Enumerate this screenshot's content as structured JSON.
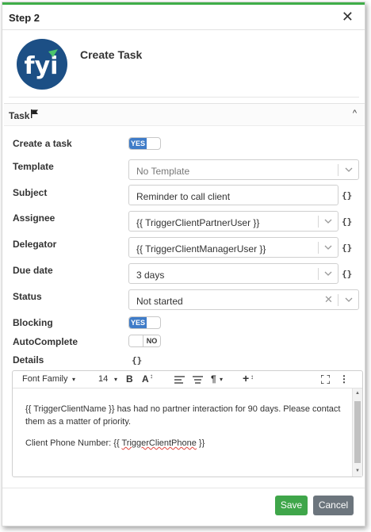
{
  "dialog": {
    "title": "Step 2"
  },
  "app": {
    "name": "Create Task",
    "logo_text": "fyi"
  },
  "section": {
    "label": "Task"
  },
  "form": {
    "create_task": {
      "label": "Create a task",
      "toggle": "YES"
    },
    "template": {
      "label": "Template",
      "value": "No Template"
    },
    "subject": {
      "label": "Subject",
      "value": "Reminder to call client"
    },
    "assignee": {
      "label": "Assignee",
      "value": "{{ TriggerClientPartnerUser }}"
    },
    "delegator": {
      "label": "Delegator",
      "value": "{{ TriggerClientManagerUser }}"
    },
    "due_date": {
      "label": "Due date",
      "value": "3 days"
    },
    "status": {
      "label": "Status",
      "value": "Not started"
    },
    "blocking": {
      "label": "Blocking",
      "toggle": "YES"
    },
    "autocomplete": {
      "label": "AutoComplete",
      "toggle": "NO"
    },
    "details": {
      "label": "Details"
    },
    "braces": "{}"
  },
  "editor": {
    "toolbar": {
      "font_family": "Font Family",
      "font_size": "14",
      "bold": "B",
      "font_color": "A",
      "paragraph": "¶",
      "insert": "+",
      "more": "⋮"
    },
    "paragraph1": "{{ TriggerClientName }} has had no partner interaction for 90 days. Please contact them as a matter of priority.",
    "paragraph2_prefix": "Client Phone Number: ",
    "paragraph2_token_open": "{{ ",
    "paragraph2_token_word": "TriggerClientPhone",
    "paragraph2_token_close": " }}"
  },
  "footer": {
    "save_label": "Save",
    "cancel_label": "Cancel"
  },
  "colors": {
    "accent_green": "#3fae49",
    "toggle_blue": "#3f7cc8",
    "logo_navy": "#1c4f85",
    "cancel_gray": "#6c757d"
  }
}
